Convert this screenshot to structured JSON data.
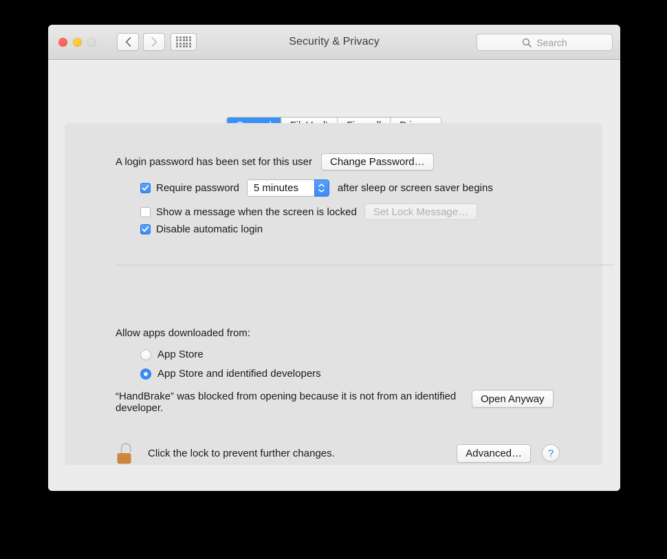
{
  "window": {
    "title": "Security & Privacy",
    "traffic_lights": [
      "close-button",
      "minimize-button",
      "zoom-button"
    ],
    "back_label": "‹",
    "forward_label": "›",
    "grid_label": "show-all-icon"
  },
  "search": {
    "placeholder": "Search",
    "value": "",
    "icon": "search-icon"
  },
  "tabs": [
    {
      "label": "General",
      "active": true
    },
    {
      "label": "FileVault",
      "active": false
    },
    {
      "label": "Firewall",
      "active": false
    },
    {
      "label": "Privacy",
      "active": false
    }
  ],
  "general": {
    "password_status": "A login password has been set for this user",
    "change_password_label": "Change Password…",
    "require_password": {
      "checked": true,
      "label": "Require password",
      "delay_value": "5 minutes",
      "suffix": "after sleep or screen saver begins"
    },
    "lock_message": {
      "checked": false,
      "label": "Show a message when the screen is locked",
      "button_label": "Set Lock Message…",
      "button_enabled": false
    },
    "disable_auto_login": {
      "checked": true,
      "label": "Disable automatic login"
    }
  },
  "gatekeeper": {
    "heading": "Allow apps downloaded from:",
    "options": [
      {
        "label": "App Store",
        "selected": false
      },
      {
        "label": "App Store and identified developers",
        "selected": true
      }
    ],
    "blocked_message": "“HandBrake” was blocked from opening because it is not from an identified developer.",
    "open_anyway_label": "Open Anyway"
  },
  "footer": {
    "lock_icon": "unlocked-padlock-icon",
    "lock_text": "Click the lock to prevent further changes.",
    "advanced_label": "Advanced…",
    "help_label": "?"
  },
  "colors": {
    "accent": "#3b8cf6",
    "window_bg": "#ececec",
    "panel_bg": "#e2e2e2"
  }
}
